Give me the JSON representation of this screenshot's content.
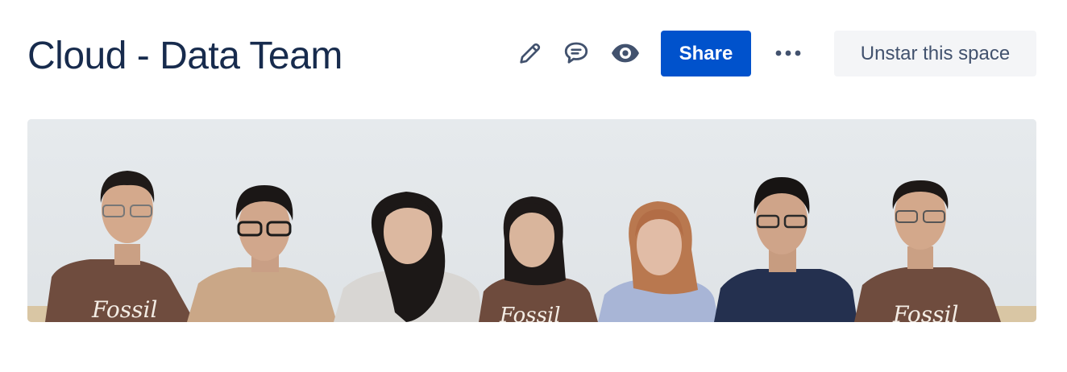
{
  "space": {
    "title": "Cloud - Data Team"
  },
  "toolbar": {
    "edit_icon": "pencil-icon",
    "comment_icon": "comment-icon",
    "watch_icon": "eye-icon",
    "share_label": "Share",
    "more_icon": "more-horizontal-icon",
    "unstar_label": "Unstar this space"
  },
  "banner": {
    "description_icon": "team-photo",
    "shirt_text": "Fossil"
  },
  "colors": {
    "title": "#172B4D",
    "icon": "#42526E",
    "primary": "#0052CC",
    "secondary_bg": "#F4F5F7"
  }
}
